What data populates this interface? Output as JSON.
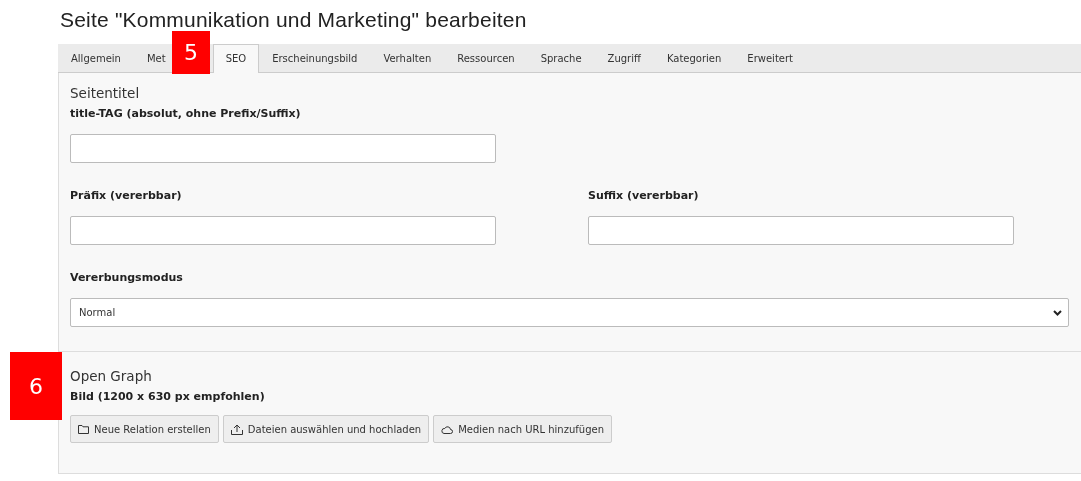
{
  "page_title": "Seite \"Kommunikation und Marketing\" bearbeiten",
  "tabs": [
    {
      "label": "Allgemein",
      "selected": false
    },
    {
      "label": "Met",
      "selected": false
    },
    {
      "label": "SEO",
      "selected": true
    },
    {
      "label": "Erscheinungsbild",
      "selected": false
    },
    {
      "label": "Verhalten",
      "selected": false
    },
    {
      "label": "Ressourcen",
      "selected": false
    },
    {
      "label": "Sprache",
      "selected": false
    },
    {
      "label": "Zugriff",
      "selected": false
    },
    {
      "label": "Kategorien",
      "selected": false
    },
    {
      "label": "Erweitert",
      "selected": false
    }
  ],
  "markers": [
    "5",
    "6"
  ],
  "seitentitel": {
    "heading": "Seitentitel",
    "title_tag_label": "title-TAG (absolut, ohne Prefix/Suffix)",
    "prefix_label": "Präfix (vererbbar)",
    "suffix_label": "Suffix (vererbbar)",
    "mode_label": "Vererbungsmodus",
    "mode_value": "Normal"
  },
  "open_graph": {
    "heading": "Open Graph",
    "image_label": "Bild (1200 x 630 px empfohlen)",
    "buttons": [
      {
        "kind": "folder",
        "label": "Neue Relation erstellen"
      },
      {
        "kind": "upload",
        "label": "Dateien auswählen und hochladen"
      },
      {
        "kind": "cloud",
        "label": "Medien nach URL hinzufügen"
      }
    ]
  }
}
